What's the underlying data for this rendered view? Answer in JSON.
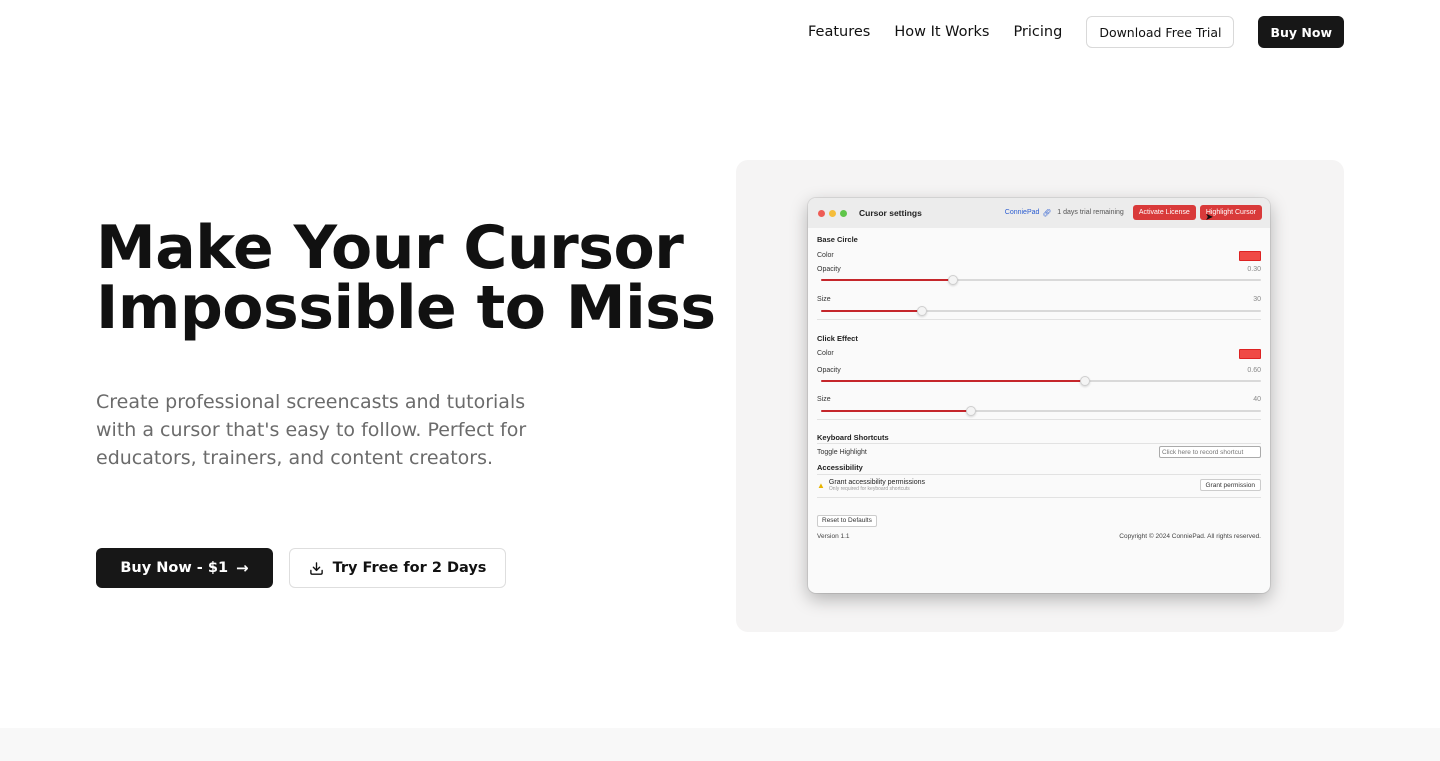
{
  "nav": {
    "links": [
      "Features",
      "How It Works",
      "Pricing"
    ],
    "download_label": "Download Free Trial",
    "buy_label": "Buy Now"
  },
  "hero": {
    "title_line1": "Make Your Cursor",
    "title_line2": "Impossible to Miss",
    "subtitle": "Create professional screencasts and tutorials with a cursor that's easy to follow. Perfect for educators, trainers, and content creators.",
    "primary_label": "Buy Now - $1",
    "primary_icon": "arrow-right-icon",
    "secondary_label": "Try Free for 2 Days",
    "secondary_icon": "download-icon"
  },
  "app": {
    "window_title": "Cursor settings",
    "brand": "ConniePad",
    "trial_text": "1 days trial remaining",
    "activate_label": "Activate License",
    "highlight_label": "Highlight Cursor",
    "accent_color": "#d93a3a",
    "base_circle": {
      "title": "Base Circle",
      "color_label": "Color",
      "color_value": "#f04a45",
      "opacity_label": "Opacity",
      "opacity_value": "0.30",
      "opacity_level": 0.3,
      "size_label": "Size",
      "size_value": "30",
      "size_level": 0.23
    },
    "click_effect": {
      "title": "Click Effect",
      "color_label": "Color",
      "color_value": "#f04a45",
      "opacity_label": "Opacity",
      "opacity_value": "0.60",
      "opacity_level": 0.6,
      "size_label": "Size",
      "size_value": "40",
      "size_level": 0.34
    },
    "shortcuts": {
      "title": "Keyboard Shortcuts",
      "toggle_label": "Toggle Highlight",
      "record_placeholder": "Click here to record shortcut"
    },
    "accessibility": {
      "title": "Accessibility",
      "grant_main": "Grant accessibility permissions",
      "grant_sub": "Only required for keyboard shortcuts",
      "grant_button": "Grant permission"
    },
    "reset_label": "Reset to Defaults",
    "version": "Version 1.1",
    "copyright": "Copyright © 2024 ConniePad. All rights reserved."
  }
}
